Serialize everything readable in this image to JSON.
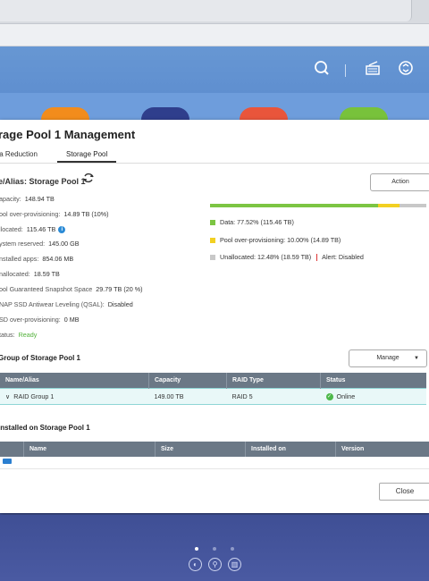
{
  "window": {
    "title": "rage Pool 1 Management",
    "tabs": [
      {
        "label": "ta Reduction"
      },
      {
        "label": "Storage Pool"
      }
    ],
    "pool_label": "e/Alias: Storage Pool 1",
    "action_label": "Action",
    "properties": [
      {
        "label": "apacity:",
        "value": "148.94 TB"
      },
      {
        "label": "ool over-provisioning:",
        "value": "14.89 TB (10%)"
      },
      {
        "label": "llocated:",
        "value": "115.46 TB"
      },
      {
        "label": "ystem reserved:",
        "value": "145.00 GB"
      },
      {
        "label": "nstalled apps:",
        "value": "854.06 MB"
      },
      {
        "label": "nallocated:",
        "value": "18.59 TB"
      },
      {
        "label": "ool Guaranteed Snapshot Space",
        "value": "29.79 TB (20 %)"
      },
      {
        "label": "NAP SSD Antiwear Leveling (QSAL):",
        "value": "Disabled"
      },
      {
        "label": "SD over-provisioning:",
        "value": "0 MB"
      },
      {
        "label": "tatus:",
        "value": "Ready"
      }
    ],
    "usage": {
      "data_fraction": 0.7752,
      "overprov_fraction": 0.1,
      "unallocated_fraction": 0.1248,
      "colors": {
        "data": "#7cc543",
        "overprov": "#f2d022",
        "unallocated": "#c8c8c8",
        "alert": "#dd3333"
      },
      "legend": {
        "data": "Data: 77.52% (115.46 TB)",
        "overprov": "Pool over-provisioning: 10.00% (14.89 TB)",
        "unallocated": "Unallocated: 12.48% (18.59 TB)",
        "alert": "Alert: Disabled"
      }
    },
    "raid_section": {
      "title": "Group of Storage Pool 1",
      "manage_label": "Manage",
      "headers": [
        "Name/Alias",
        "Capacity",
        "RAID Type",
        "Status"
      ],
      "rows": [
        {
          "name": "RAID Group 1",
          "capacity": "149.00 TB",
          "raid_type": "RAID 5",
          "status": "Online"
        }
      ]
    },
    "apps_section": {
      "title": "installed on Storage Pool 1",
      "headers": [
        "Name",
        "Size",
        "Installed on",
        "Version"
      ]
    },
    "close_label": "Close"
  },
  "header_icons": [
    "search-icon",
    "notes-icon",
    "sync-icon"
  ],
  "dock_icons": [
    "dashboard-icon",
    "search-app-icon",
    "notes-app-icon"
  ],
  "page_dots": 3
}
